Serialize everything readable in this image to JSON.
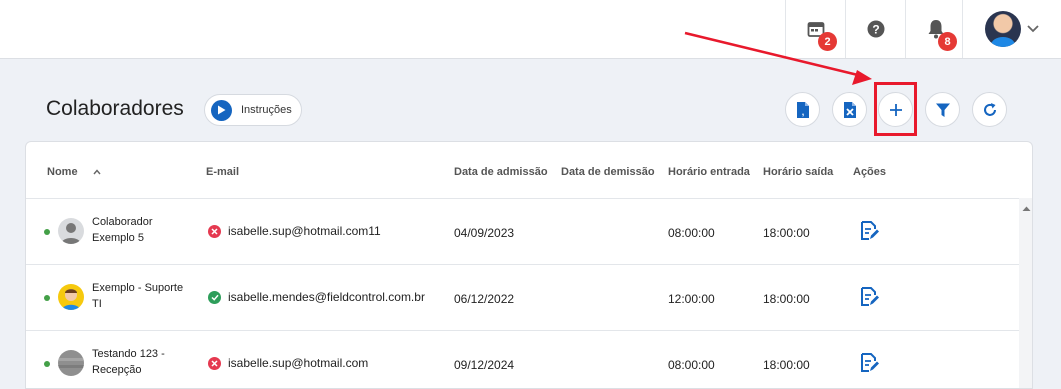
{
  "topbar": {
    "calendar_badge": "2",
    "notifications_badge": "8"
  },
  "header": {
    "title": "Colaboradores",
    "instructions_label": "Instruções"
  },
  "table": {
    "columns": [
      "Nome",
      "E-mail",
      "Data de admissão",
      "Data de demissão",
      "Horário entrada",
      "Horário saída",
      "Ações"
    ],
    "rows": [
      {
        "name_line1": "Colaborador",
        "name_line2": "Exemplo 5",
        "email": "isabelle.sup@hotmail.com11",
        "email_status": "invalid",
        "admission": "04/09/2023",
        "dismissal": "",
        "entry": "08:00:00",
        "exit": "18:00:00"
      },
      {
        "name_line1": "Exemplo - Suporte",
        "name_line2": "TI",
        "email": "isabelle.mendes@fieldcontrol.com.br",
        "email_status": "valid",
        "admission": "06/12/2022",
        "dismissal": "",
        "entry": "12:00:00",
        "exit": "18:00:00"
      },
      {
        "name_line1": "Testando 123 -",
        "name_line2": "Recepção",
        "email": "isabelle.sup@hotmail.com",
        "email_status": "invalid",
        "admission": "09/12/2024",
        "dismissal": "",
        "entry": "08:00:00",
        "exit": "18:00:00"
      }
    ]
  },
  "colors": {
    "accent": "#1565c0",
    "highlight": "#e8192c",
    "active_status": "#43a047",
    "email_invalid": "#e53950",
    "email_valid": "#2e9e5b",
    "badge": "#e53935"
  },
  "icons": {
    "calendar": "calendar-icon",
    "help": "help-icon",
    "bell": "bell-icon",
    "play": "play-icon",
    "export_txt": "export-file-icon",
    "export_excel": "excel-icon",
    "add": "plus-icon",
    "filter": "filter-icon",
    "refresh": "refresh-icon",
    "sort": "sort-up-icon",
    "edit": "edit-document-icon"
  }
}
